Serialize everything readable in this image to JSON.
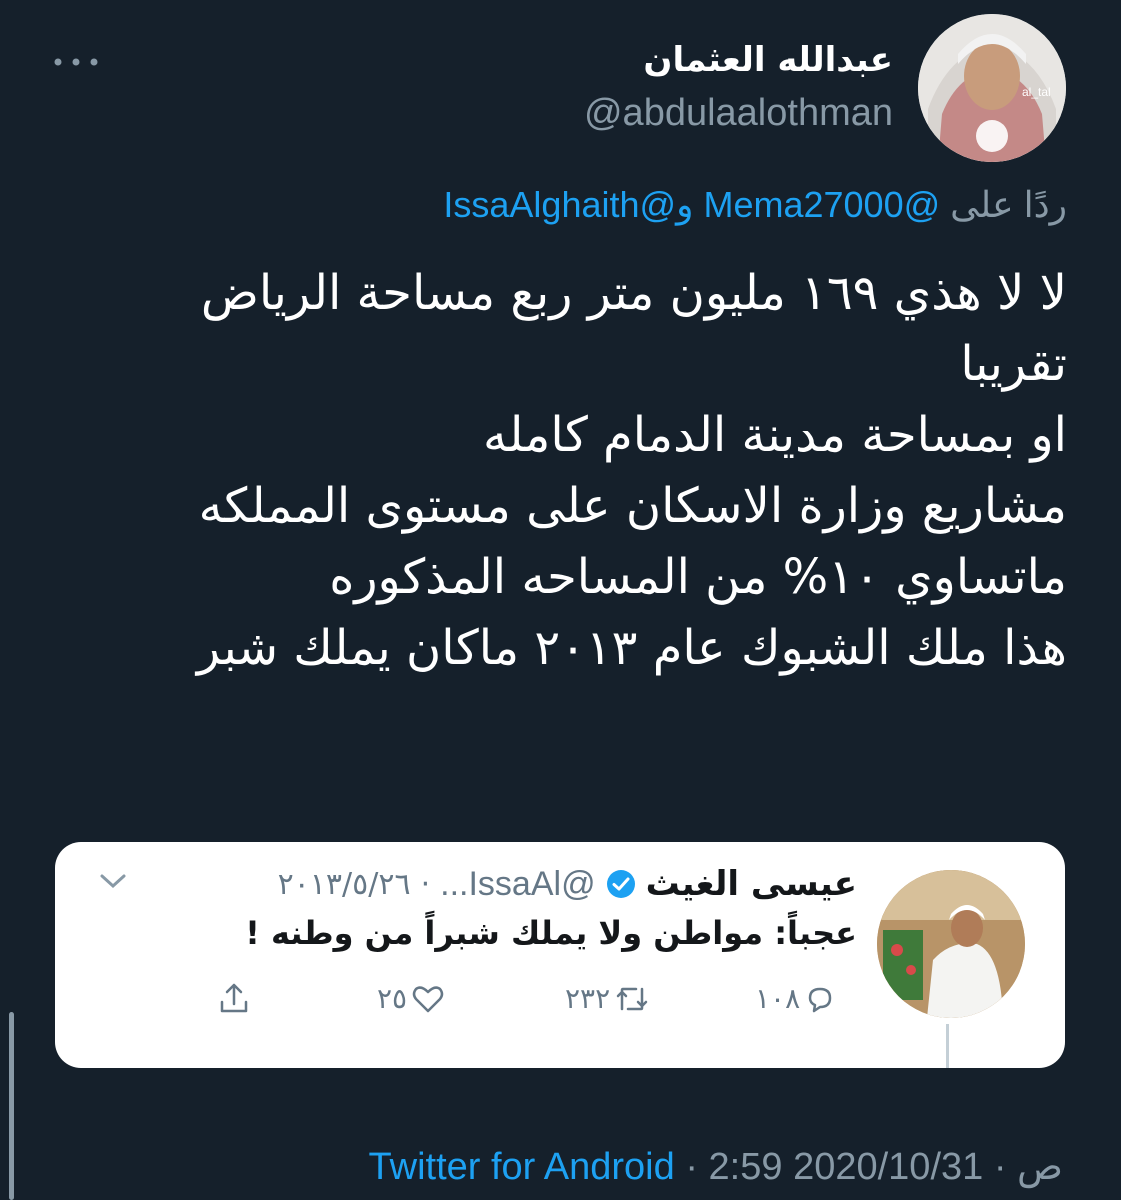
{
  "author": {
    "display_name": "عبدالله العثمان",
    "handle": "@abdulaalothman",
    "avatar_icon": "profile-photo",
    "more_icon": "more-dots-icon"
  },
  "reply_to": {
    "prefix": "ردًا على",
    "mention_1": "@Mema27000",
    "conjunction": "و",
    "mention_2": "@IssaAlghaith"
  },
  "tweet_lines": [
    "لا لا هذي ١٦٩ مليون متر ربع مساحة الرياض",
    "تقريبا",
    "او بمساحة مدينة الدمام كامله",
    "مشاريع وزارة الاسكان على مستوى المملكه",
    "ماتساوي ١٠% من المساحه المذكوره",
    "هذا ملك الشبوك عام ٢٠١٣ ماكان يملك شبر"
  ],
  "quoted_tweet": {
    "name": "عيسى الغيث",
    "handle": "@IssaAl...",
    "date": "٢٠١٣/٥/٢٦",
    "separator": "·",
    "text": "عجباً: مواطن ولا يملك شبراً من وطنه !",
    "replies": "١٠٨",
    "retweets": "٢٣٢",
    "likes": "٢٥"
  },
  "footer": {
    "date": "2020/10/31",
    "sep": "·",
    "time": "2:59 ص",
    "source": "Twitter for Android"
  },
  "colors": {
    "background": "#15202b",
    "accent": "#1da1f2",
    "muted": "#8899a6"
  }
}
